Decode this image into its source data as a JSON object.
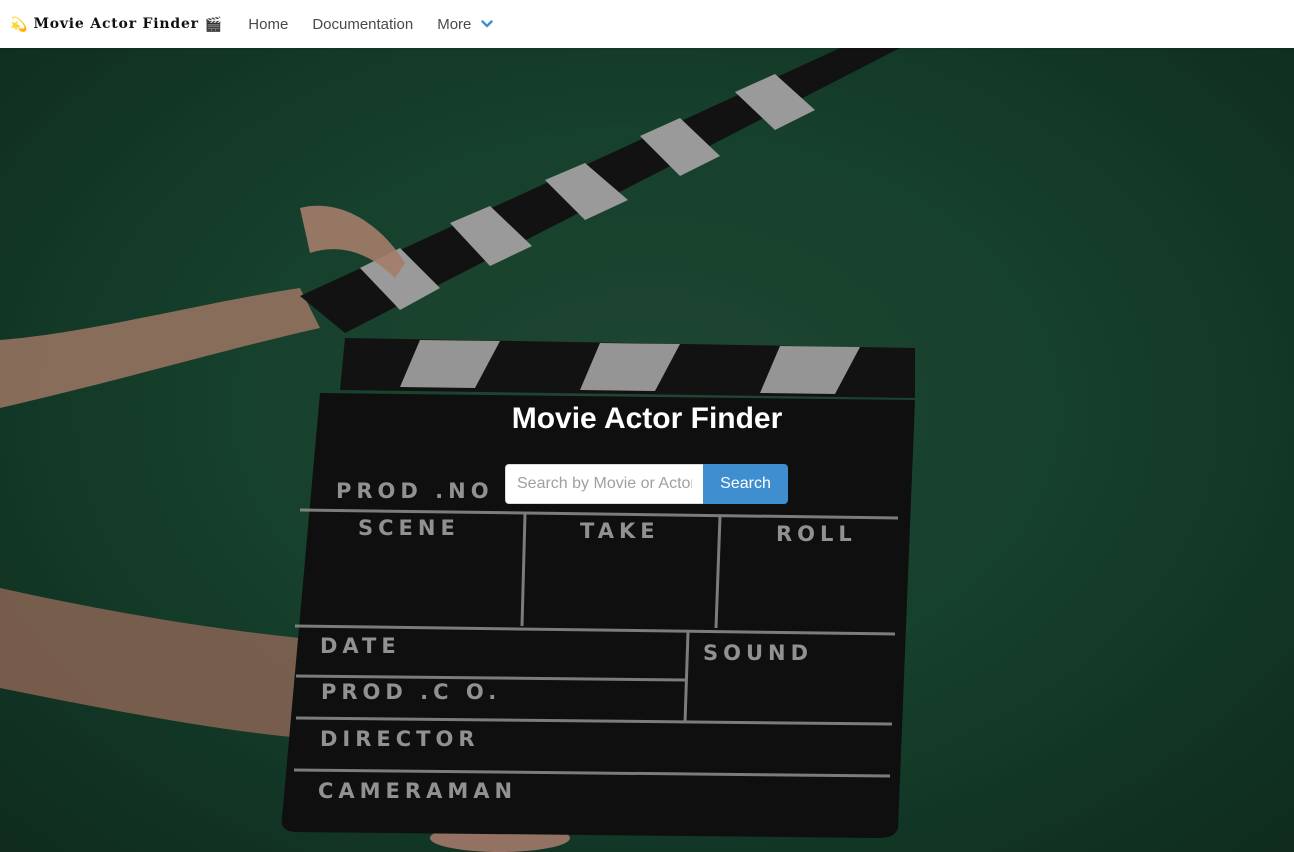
{
  "navbar": {
    "brand": {
      "left_emoji": "💫",
      "title": "Movie Actor Finder",
      "right_emoji": "🎬"
    },
    "items": [
      {
        "label": "Home"
      },
      {
        "label": "Documentation"
      },
      {
        "label": "More",
        "icon": "chevron-down-icon"
      }
    ]
  },
  "hero": {
    "title": "Movie Actor Finder",
    "background_image": "clapperboard held by hand on green background",
    "clapperboard_labels": {
      "prod_no": "PROD .NO",
      "scene": "SCENE",
      "take": "TAKE",
      "roll": "ROLL",
      "date": "DATE",
      "sound": "SOUND",
      "prod_co": "PROD .C O.",
      "director": "DIRECTOR",
      "cameraman": "CAMERAMAN"
    }
  },
  "search": {
    "placeholder": "Search by Movie or Actor",
    "value": "",
    "button_label": "Search"
  },
  "colors": {
    "accent": "#3e8ed0",
    "background_green": "#1f5a3e"
  }
}
